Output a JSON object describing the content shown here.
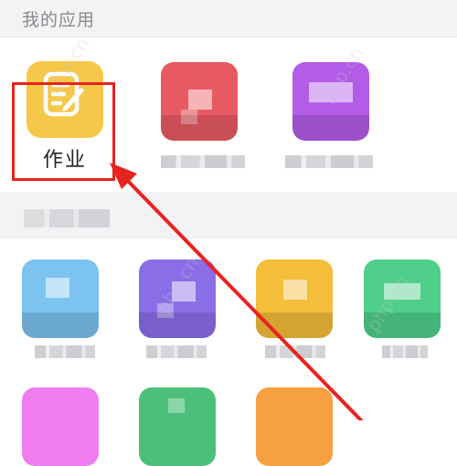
{
  "header": {
    "title": "我的应用"
  },
  "apps_top": [
    {
      "label": "作业",
      "icon": "homework-icon",
      "color": "#f6c84a"
    },
    {
      "label": "",
      "icon": "app-icon-red",
      "color": "#e85a63"
    },
    {
      "label": "",
      "icon": "app-icon-purple",
      "color": "#b25ce8"
    }
  ],
  "apps_bottom": [
    {
      "icon": "app-icon-blue",
      "color": "#7dc3f0"
    },
    {
      "icon": "app-icon-violet",
      "color": "#8a6ee8"
    },
    {
      "icon": "app-icon-gold",
      "color": "#f4bd3a"
    },
    {
      "icon": "app-icon-green",
      "color": "#4fcf8a"
    },
    {
      "icon": "app-icon-pink",
      "color": "#f07ef0"
    },
    {
      "icon": "app-icon-teal",
      "color": "#4cc07a"
    },
    {
      "icon": "app-icon-orange",
      "color": "#f6a040"
    }
  ],
  "colors": {
    "highlight": "#e8231f",
    "header_bg": "#f3f3f5"
  }
}
